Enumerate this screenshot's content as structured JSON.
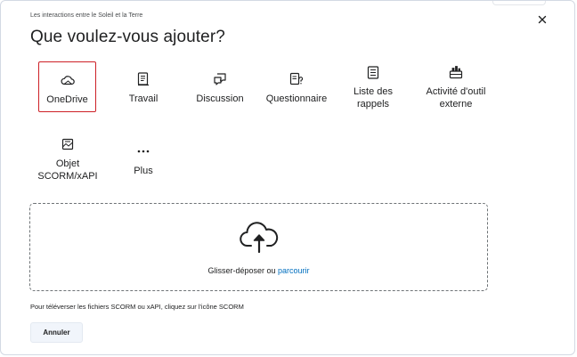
{
  "dialog": {
    "breadcrumb": "Les interactions entre le Soleil et la Terre",
    "title": "Que voulez-vous ajouter?",
    "close_icon": "close-icon"
  },
  "tiles": {
    "onedrive": {
      "label": "OneDrive",
      "icon": "cloud-icon",
      "selected": true
    },
    "travail": {
      "label": "Travail",
      "icon": "assignment-icon"
    },
    "discussion": {
      "label": "Discussion",
      "icon": "discussion-icon"
    },
    "questionnaire": {
      "label": "Questionnaire",
      "icon": "quiz-icon"
    },
    "checklist": {
      "label_line1": "Liste des",
      "label_line2": "rappels",
      "icon": "checklist-icon"
    },
    "lti": {
      "label_line1": "Activité d'outil",
      "label_line2": "externe",
      "icon": "external-tool-icon"
    },
    "scorm": {
      "label_line1": "Objet",
      "label_line2": "SCORM/xAPI",
      "icon": "scorm-package-icon"
    },
    "more": {
      "label": "Plus",
      "icon": "more-dots-icon"
    }
  },
  "dropzone": {
    "text": "Glisser-déposer ou",
    "browse_link": "parcourir",
    "icon": "cloud-upload-icon"
  },
  "hint": "Pour téléverser les fichiers SCORM ou xAPI, cliquez sur l'icône SCORM",
  "footer": {
    "cancel_label": "Annuler"
  },
  "colors": {
    "selected_border": "#cd2026",
    "link": "#006fbf",
    "button_bg": "#f1f5fb"
  }
}
